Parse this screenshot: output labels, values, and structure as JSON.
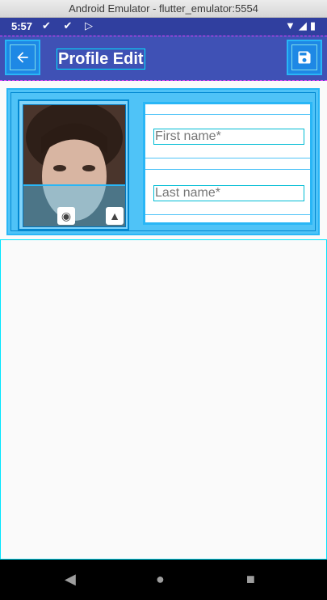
{
  "window": {
    "title": "Android Emulator - flutter_emulator:5554"
  },
  "status_bar": {
    "time": "5:57",
    "left_icons": "✔ ✔ ▷",
    "right_icons": "▼◢▮"
  },
  "app_bar": {
    "title": "Profile Edit",
    "back_icon": "arrow-back-icon",
    "save_icon": "save-icon"
  },
  "form": {
    "first_name_placeholder": "First name*",
    "last_name_placeholder": "Last name*"
  },
  "photo": {
    "camera_icon": "camera-icon",
    "gallery_icon": "image-icon"
  },
  "nav_bar": {
    "back": "◀",
    "home": "●",
    "recents": "■"
  },
  "colors": {
    "primary": "#3f51b5",
    "primary_dark": "#303f9f",
    "debug_overlay": "#29b6f6"
  }
}
